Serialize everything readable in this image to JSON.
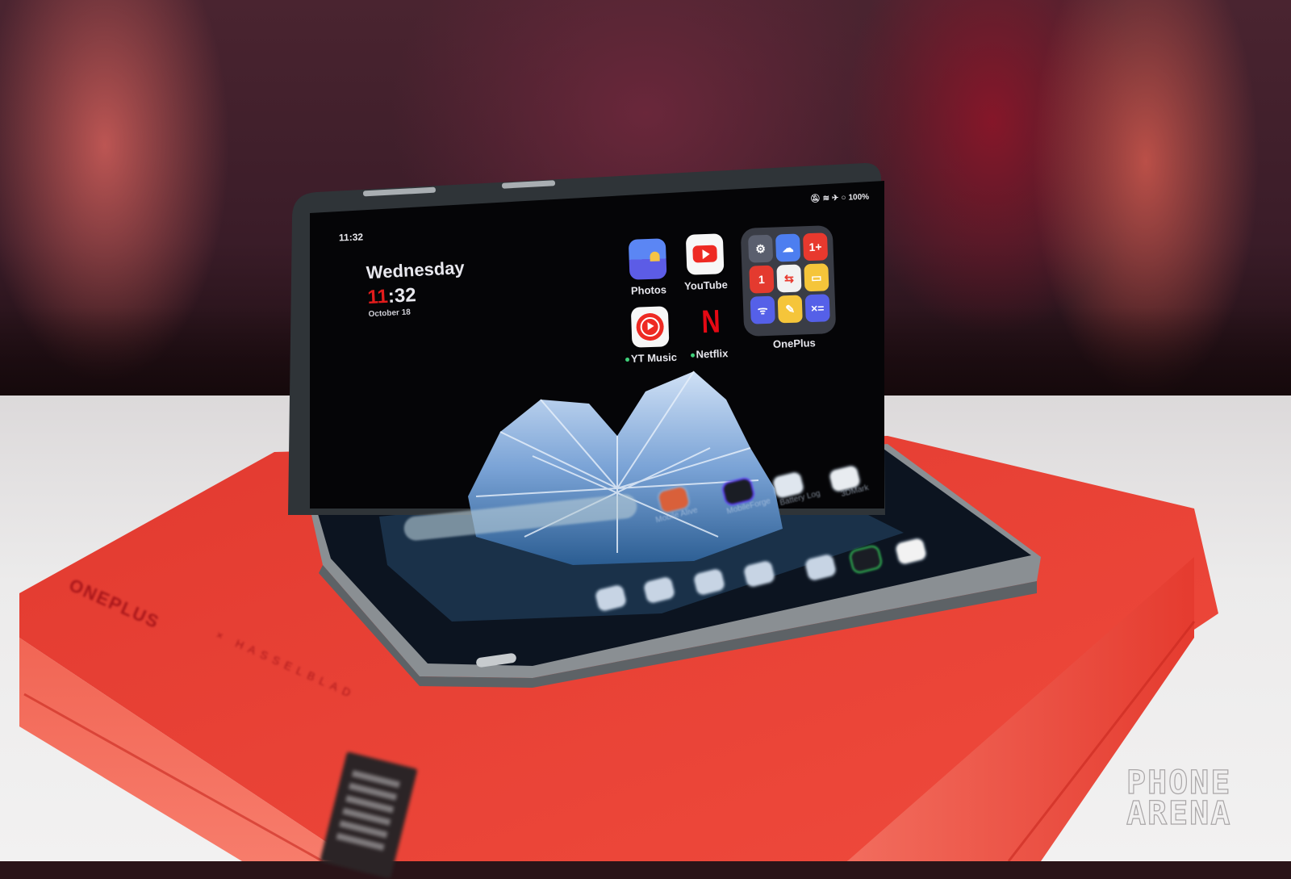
{
  "scene": {
    "description": "Photo of a foldable phone half-open in tent mode on a red box",
    "box_color": "#e8392e",
    "box_brand": "ONEPLUS",
    "box_collab": "× HASSELBLAD",
    "watermark": [
      "PHONE",
      "ARENA"
    ]
  },
  "status_bar": {
    "time": "11:32",
    "icons": [
      "mute-icon",
      "wifi-icon",
      "airplane-icon",
      "battery-icon"
    ],
    "battery": "100%"
  },
  "clock_widget": {
    "day": "Wednesday",
    "hour": "11",
    "minutes": ":32",
    "date": "October 18"
  },
  "apps": [
    {
      "name": "photos",
      "label": "Photos",
      "new": false
    },
    {
      "name": "youtube",
      "label": "YouTube",
      "new": false
    },
    {
      "name": "yt-music",
      "label": "YT Music",
      "new": true
    },
    {
      "name": "netflix",
      "label": "Netflix",
      "new": true
    }
  ],
  "folder": {
    "label": "OnePlus",
    "apps": [
      {
        "icon": "settings-icon",
        "color": "#5a5f6e",
        "glyph": "⚙"
      },
      {
        "icon": "weather-icon",
        "color": "#4d7ef0",
        "glyph": "☁"
      },
      {
        "icon": "oneplus-community-icon",
        "color": "#e8392e",
        "glyph": "1+"
      },
      {
        "icon": "calendar-icon",
        "color": "#e43a2f",
        "glyph": "1"
      },
      {
        "icon": "clone-phone-icon",
        "color": "#f2f2f2",
        "glyph": "⇆"
      },
      {
        "icon": "files-icon",
        "color": "#f5c53a",
        "glyph": "▭"
      },
      {
        "icon": "remote-icon",
        "color": "#5560e8",
        "glyph": "ᯤ"
      },
      {
        "icon": "notes-icon",
        "color": "#f5c53a",
        "glyph": "✎"
      },
      {
        "icon": "calculator-icon",
        "color": "#5560e8",
        "glyph": "×="
      }
    ]
  },
  "lower_screen": {
    "apps": [
      {
        "label": "Mobile Alive",
        "color": "#d9603a"
      },
      {
        "label": "MobileForge",
        "color": "#1a1d24"
      },
      {
        "label": "Battery Log",
        "color": "#dfe6ee"
      },
      {
        "label": "3DMark",
        "color": "#e8ecf0"
      }
    ],
    "search_bar": "Google search",
    "dock": [
      "phone-icon",
      "messages-icon",
      "chrome-icon",
      "camera-icon",
      "photos-icon",
      "mobileforge-icon",
      "youtube-icon"
    ]
  }
}
